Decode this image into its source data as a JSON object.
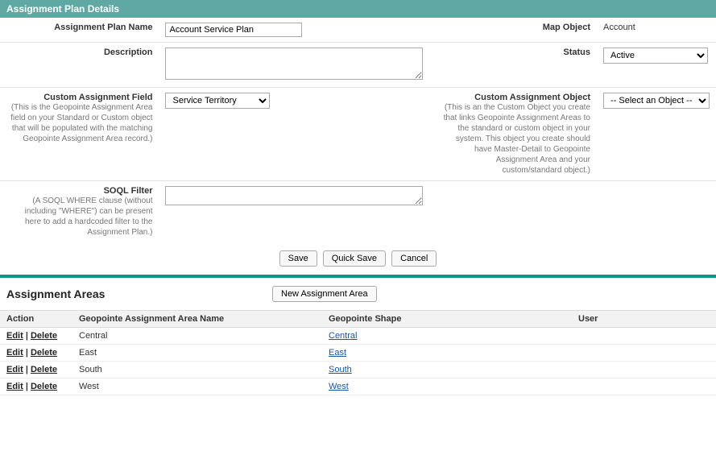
{
  "header": {
    "title": "Assignment Plan Details"
  },
  "fields": {
    "plan_name": {
      "label": "Assignment Plan Name",
      "value": "Account Service Plan"
    },
    "map_object": {
      "label": "Map Object",
      "value": "Account"
    },
    "description": {
      "label": "Description",
      "value": ""
    },
    "status": {
      "label": "Status",
      "value": "Active"
    },
    "custom_assignment_field": {
      "label": "Custom Assignment Field",
      "help": "(This is the Geopointe Assignment Area field on your Standard or Custom object that will be populated with the matching Geopointe Assignment Area record.)",
      "value": "Service Territory"
    },
    "custom_assignment_object": {
      "label": "Custom Assignment Object",
      "help": "(This is an the Custom Object you create that links Geopointe Assignment Areas to the standard or custom object in your system. This object you create should have Master-Detail to Geopointe Assignment Area and your custom/standard object.)",
      "value": "-- Select an Object --"
    },
    "soql_filter": {
      "label": "SOQL Filter",
      "help": "(A SOQL WHERE clause (without including \"WHERE\") can be present here to add a hardcoded filter to the Assignment Plan.)",
      "value": ""
    }
  },
  "buttons": {
    "save": "Save",
    "quick_save": "Quick Save",
    "cancel": "Cancel",
    "new_area": "New Assignment Area"
  },
  "areas": {
    "title": "Assignment Areas",
    "columns": {
      "action": "Action",
      "name": "Geopointe Assignment Area Name",
      "shape": "Geopointe Shape",
      "user": "User"
    },
    "action_labels": {
      "edit": "Edit",
      "delete": "Delete"
    },
    "rows": [
      {
        "name": "Central",
        "shape": "Central",
        "user": ""
      },
      {
        "name": "East",
        "shape": "East",
        "user": ""
      },
      {
        "name": "South",
        "shape": "South",
        "user": ""
      },
      {
        "name": "West",
        "shape": "West",
        "user": ""
      }
    ]
  }
}
